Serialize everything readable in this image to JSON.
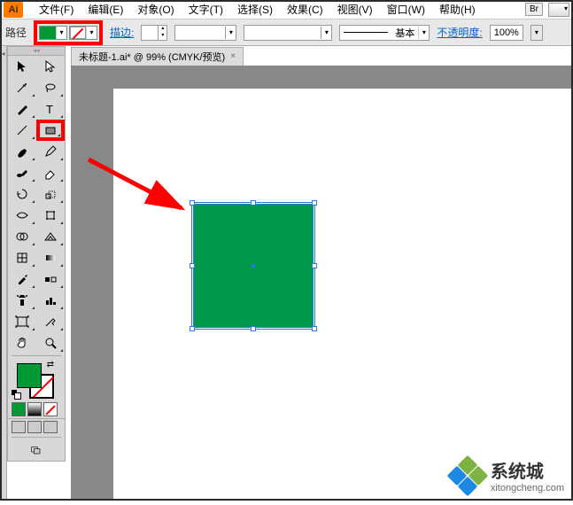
{
  "app": {
    "icon_label": "Ai"
  },
  "menu": {
    "file": "文件(F)",
    "edit": "编辑(E)",
    "object": "对象(O)",
    "text": "文字(T)",
    "select": "选择(S)",
    "effect": "效果(C)",
    "view": "视图(V)",
    "window": "窗口(W)",
    "help": "帮助(H)",
    "br_badge": "Br"
  },
  "options": {
    "path_label": "路径",
    "fill_color": "#009933",
    "stroke_label": "描边:",
    "stroke_width": "",
    "basic_label": "基本",
    "opacity_label": "不透明度:",
    "opacity_value": "100%"
  },
  "tab": {
    "title": "未标题-1.ai* @ 99% (CMYK/预览)",
    "close": "×"
  },
  "canvas": {
    "shape_fill": "#00994c"
  },
  "watermark": {
    "title": "系统城",
    "url": "xitongcheng.com"
  }
}
